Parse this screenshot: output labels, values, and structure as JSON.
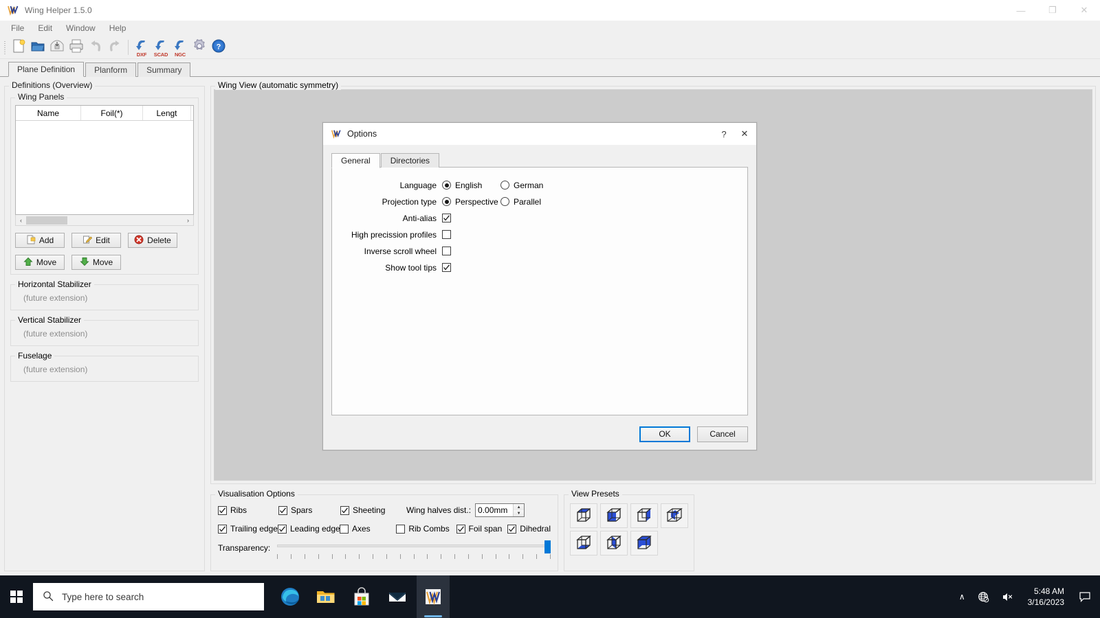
{
  "app": {
    "title": "Wing Helper 1.5.0",
    "icon": "wing-helper-logo-icon",
    "window_controls": {
      "minimize": "—",
      "maximize": "❐",
      "close": "✕"
    },
    "menu": [
      "File",
      "Edit",
      "Window",
      "Help"
    ],
    "toolbar": [
      {
        "name": "new-file-button",
        "label": "",
        "icon": "new-document-icon"
      },
      {
        "name": "open-file-button",
        "label": "",
        "icon": "open-folder-icon"
      },
      {
        "name": "save-file-button",
        "label": "",
        "icon": "save-disk-icon"
      },
      {
        "name": "print-button",
        "label": "",
        "icon": "printer-icon"
      },
      {
        "name": "undo-button",
        "label": "",
        "icon": "undo-arrow-icon"
      },
      {
        "name": "redo-button",
        "label": "",
        "icon": "redo-arrow-icon"
      },
      {
        "name": "export-dxf-button",
        "label": "DXF",
        "icon": "export-arrow-icon"
      },
      {
        "name": "export-scad-button",
        "label": "SCAD",
        "icon": "export-arrow-icon"
      },
      {
        "name": "export-ngc-button",
        "label": "NGC",
        "icon": "export-arrow-icon"
      },
      {
        "name": "options-button",
        "label": "",
        "icon": "gear-icon"
      },
      {
        "name": "help-button",
        "label": "",
        "icon": "question-help-icon"
      }
    ],
    "tabs": [
      {
        "label": "Plane Definition",
        "active": true
      },
      {
        "label": "Planform",
        "active": false
      },
      {
        "label": "Summary",
        "active": false
      }
    ]
  },
  "left_panel": {
    "definitions_title": "Definitions (Overview)",
    "wing_panels": {
      "title": "Wing Panels",
      "columns": [
        "Name",
        "Foil(*)",
        "Lengt"
      ],
      "rows": [],
      "scrollbar": {
        "left_arrow": "‹",
        "right_arrow": "›"
      }
    },
    "buttons": [
      {
        "label": "Add",
        "icon": "add-page-icon"
      },
      {
        "label": "Edit",
        "icon": "edit-pencil-icon"
      },
      {
        "label": "Delete",
        "icon": "delete-cross-icon"
      },
      {
        "label": "Move",
        "icon": "move-up-arrow-icon"
      },
      {
        "label": "Move",
        "icon": "move-down-arrow-icon"
      }
    ],
    "sections": [
      {
        "title": "Horizontal Stabilizer",
        "content": "(future extension)"
      },
      {
        "title": "Vertical Stabilizer",
        "content": "(future extension)"
      },
      {
        "title": "Fuselage",
        "content": "(future extension)"
      }
    ]
  },
  "wing_view": {
    "title": "Wing View (automatic symmetry)",
    "background_color": "#cccccc"
  },
  "visualisation": {
    "title": "Visualisation Options",
    "row1": [
      {
        "label": "Ribs",
        "checked": true
      },
      {
        "label": "Spars",
        "checked": true
      },
      {
        "label": "Sheeting",
        "checked": true
      }
    ],
    "row2": [
      {
        "label": "Trailing edge",
        "checked": true
      },
      {
        "label": "Leading edge",
        "checked": true
      },
      {
        "label": "Axes",
        "checked": false
      },
      {
        "label": "Rib Combs",
        "checked": false
      },
      {
        "label": "Foil span",
        "checked": true
      },
      {
        "label": "Dihedral",
        "checked": true
      }
    ],
    "wing_halves": {
      "label": "Wing halves dist.:",
      "value": "0.00mm",
      "up_arrow": "▲",
      "down_arrow": "▼"
    },
    "transparency": {
      "label": "Transparency:",
      "value": 100,
      "min": 0,
      "max": 100
    }
  },
  "view_presets": {
    "title": "View Presets",
    "items": [
      {
        "name": "view-preset-top"
      },
      {
        "name": "view-preset-front-left"
      },
      {
        "name": "view-preset-right"
      },
      {
        "name": "view-preset-isometric-small"
      },
      {
        "name": "view-preset-bottom"
      },
      {
        "name": "view-preset-left"
      },
      {
        "name": "view-preset-back"
      }
    ]
  },
  "options_dialog": {
    "title": "Options",
    "icon": "wing-helper-logo-icon",
    "help_glyph": "?",
    "close_glyph": "✕",
    "tabs": [
      {
        "label": "General",
        "active": true
      },
      {
        "label": "Directories",
        "active": false
      }
    ],
    "fields": {
      "language": {
        "label": "Language",
        "options": [
          {
            "label": "English",
            "selected": true
          },
          {
            "label": "German",
            "selected": false
          }
        ]
      },
      "projection": {
        "label": "Projection type",
        "options": [
          {
            "label": "Perspective",
            "selected": true
          },
          {
            "label": "Parallel",
            "selected": false
          }
        ]
      },
      "checkboxes": [
        {
          "label": "Anti-alias",
          "checked": true
        },
        {
          "label": "High precission profiles",
          "checked": false
        },
        {
          "label": "Inverse scroll wheel",
          "checked": false
        },
        {
          "label": "Show tool tips",
          "checked": true
        }
      ]
    },
    "ok_label": "OK",
    "cancel_label": "Cancel"
  },
  "taskbar": {
    "start_icon": "windows-start-icon",
    "search": {
      "icon": "search-icon",
      "placeholder": "Type here to search"
    },
    "apps": [
      {
        "name": "taskbar-edge",
        "label": "Microsoft Edge"
      },
      {
        "name": "taskbar-file-explorer",
        "label": "File Explorer"
      },
      {
        "name": "taskbar-microsoft-store",
        "label": "Microsoft Store"
      },
      {
        "name": "taskbar-mail",
        "label": "Mail"
      },
      {
        "name": "taskbar-wing-helper",
        "label": "Wing Helper"
      }
    ],
    "tray": {
      "chevron": "∧",
      "network_icon": "network-globe-icon",
      "volume_icon": "volume-muted-icon",
      "time": "5:48 AM",
      "date": "3/16/2023",
      "action_center_icon": "action-center-icon"
    }
  },
  "colors": {
    "accent": "#0078d7",
    "window_bg": "#f0f0f0",
    "canvas_bg": "#cccccc",
    "taskbar_bg": "#10161f",
    "export_label": "#c0392b"
  }
}
